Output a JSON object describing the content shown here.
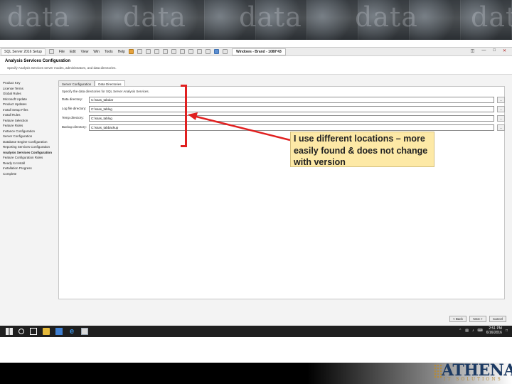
{
  "banner": {
    "word": "data"
  },
  "toolbar": {
    "app_tab": "SQL Server 2016 Setup",
    "menu": [
      "File",
      "Edit",
      "View",
      "Win",
      "Tools",
      "Help"
    ],
    "window_tab": "Windows - Brand - 1080*43"
  },
  "header": {
    "title": "Analysis Services Configuration",
    "subtitle": "Specify Analysis Services server modes, administrators, and data directories."
  },
  "sidebar": {
    "items": [
      {
        "label": "Product Key",
        "active": false
      },
      {
        "label": "License Terms",
        "active": false
      },
      {
        "label": "Global Rules",
        "active": false
      },
      {
        "label": "Microsoft Update",
        "active": false
      },
      {
        "label": "Product Updates",
        "active": false
      },
      {
        "label": "Install Setup Files",
        "active": false
      },
      {
        "label": "Install Rules",
        "active": false
      },
      {
        "label": "Feature Selection",
        "active": false
      },
      {
        "label": "Feature Rules",
        "active": false
      },
      {
        "label": "Instance Configuration",
        "active": false
      },
      {
        "label": "Server Configuration",
        "active": false
      },
      {
        "label": "Database Engine Configuration",
        "active": false
      },
      {
        "label": "Reporting Services Configuration",
        "active": false
      },
      {
        "label": "Analysis Services Configuration",
        "active": true
      },
      {
        "label": "Feature Configuration Rules",
        "active": false
      },
      {
        "label": "Ready to Install",
        "active": false
      },
      {
        "label": "Installation Progress",
        "active": false
      },
      {
        "label": "Complete",
        "active": false
      }
    ]
  },
  "tabs": [
    "Server Configuration",
    "Data Directories"
  ],
  "panel": {
    "instruction": "Specify the data directories for SQL Server Analysis Services.",
    "rows": [
      {
        "label": "Data directory:",
        "value": "C:\\ssas_tabular",
        "button": "..."
      },
      {
        "label": "Log file directory:",
        "value": "C:\\ssas_tablog",
        "button": "..."
      },
      {
        "label": "Temp directory:",
        "value": "C:\\ssas_tablog",
        "button": "..."
      },
      {
        "label": "Backup directory:",
        "value": "C:\\ssas_tabbackup",
        "button": "..."
      }
    ]
  },
  "footer": {
    "back": "< Back",
    "next": "Next >",
    "cancel": "Cancel"
  },
  "taskbar": {
    "time": "2:51 PM",
    "date": "6/16/2016"
  },
  "callout": {
    "text": "I use different locations – more easily found & does not change with version",
    "accent_color": "#e02020",
    "background": "#fde9a6"
  },
  "logo": {
    "name": "ATHENA",
    "tagline": "IT SOLUTIONS"
  }
}
